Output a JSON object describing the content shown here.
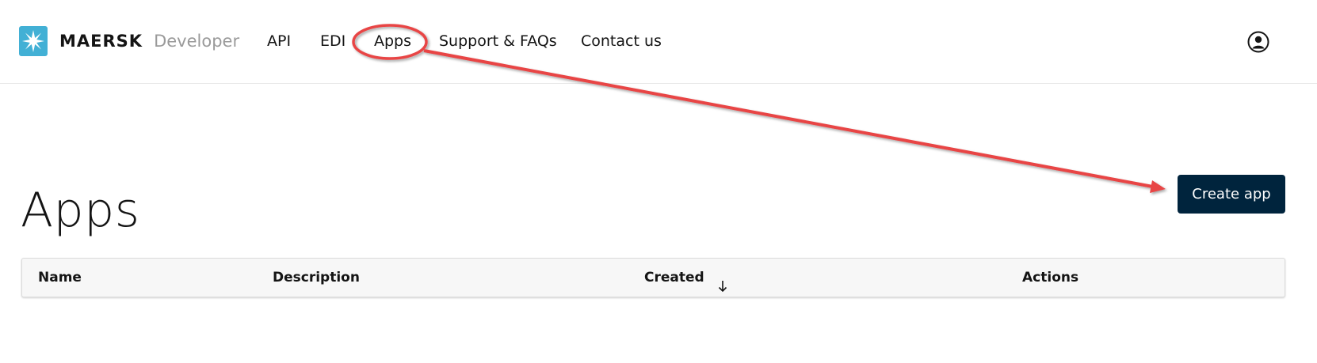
{
  "header": {
    "brand": "MAERSK",
    "brand_sub": "Developer",
    "nav": [
      {
        "label": "API"
      },
      {
        "label": "EDI"
      },
      {
        "label": "Apps"
      },
      {
        "label": "Support & FAQs"
      },
      {
        "label": "Contact us"
      }
    ],
    "user_icon": "user-circle-icon"
  },
  "main": {
    "title": "Apps",
    "create_button_label": "Create app",
    "table": {
      "columns": [
        {
          "label": "Name"
        },
        {
          "label": "Description"
        },
        {
          "label": "Created",
          "sort": "descending"
        },
        {
          "label": "Actions"
        }
      ]
    }
  },
  "annotation": {
    "color": "#e84545",
    "type": "circle-with-arrow"
  },
  "colors": {
    "brand_star_bg": "#42b0d5",
    "primary_button": "#00243d"
  }
}
